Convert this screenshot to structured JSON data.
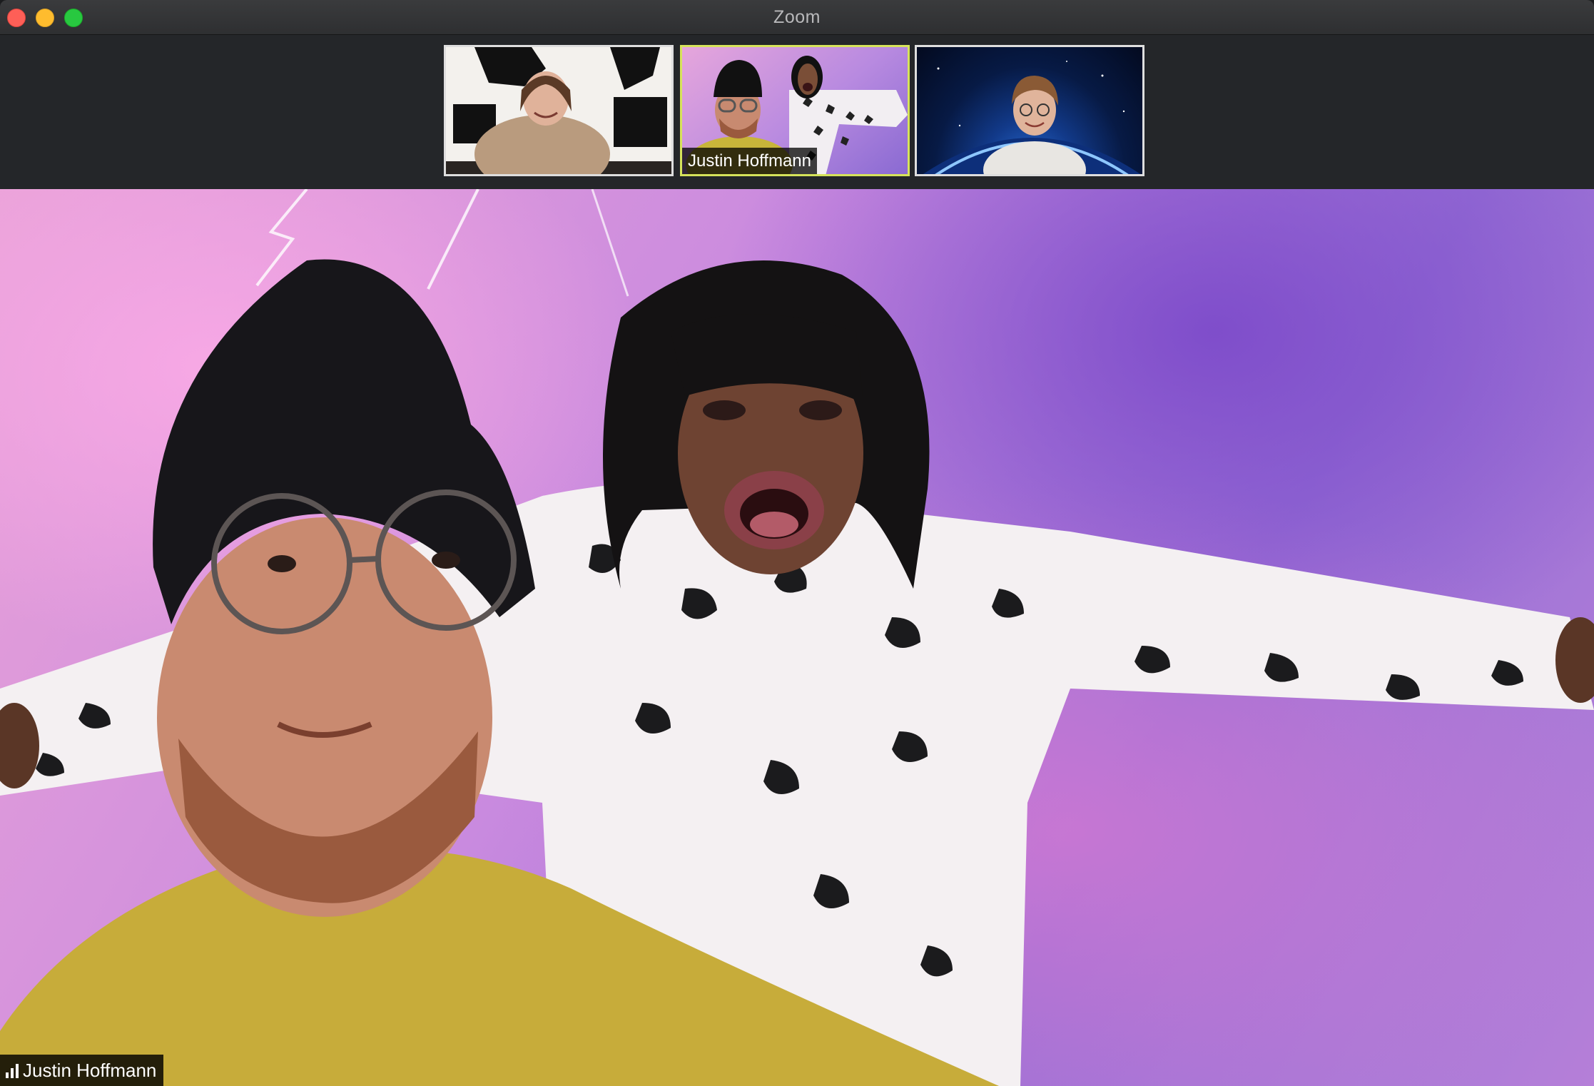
{
  "window": {
    "title": "Zoom"
  },
  "gallery": {
    "participants": [
      {
        "name": "",
        "active": false
      },
      {
        "name": "Justin Hoffmann",
        "active": true
      },
      {
        "name": "",
        "active": false
      }
    ]
  },
  "main_view": {
    "speaker_name": "Justin Hoffmann",
    "audio_indicator_icon": "signal-bars-icon"
  },
  "colors": {
    "active_speaker_border": "#d6e35a",
    "close": "#fe5f57",
    "minimize": "#febc2e",
    "maximize": "#28c840"
  }
}
